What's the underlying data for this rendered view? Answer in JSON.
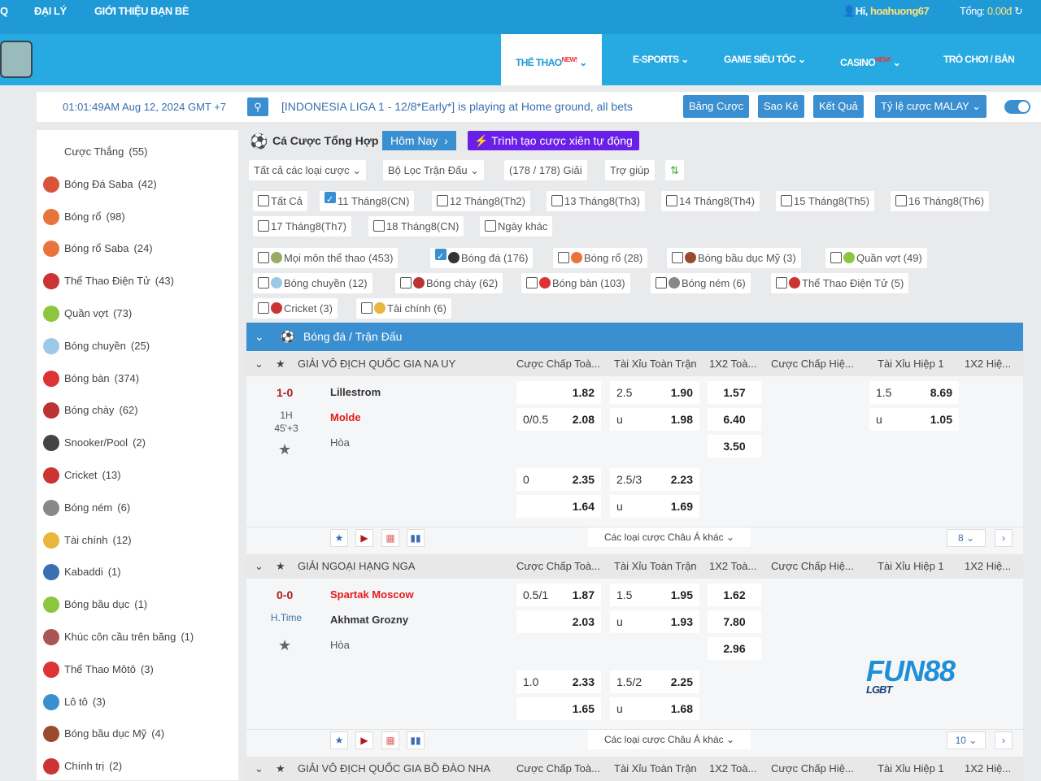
{
  "topbar": {
    "q": "Q",
    "agent": "ĐẠI LÝ",
    "refer": "GIỚI THIỆU BẠN BÈ",
    "greeting": "Hi,",
    "username": "hoahuong67",
    "total_label": "Tổng:",
    "total_value": "0.00đ"
  },
  "nav": [
    {
      "label": "THỂ THAO",
      "badge": "NEW!",
      "active": true
    },
    {
      "label": "E-SPORTS"
    },
    {
      "label": "GAME SIÊU TỐC"
    },
    {
      "label": "CASINO",
      "badge": "NEW!"
    },
    {
      "label": "TRÒ CHƠI / BẮN CÁ"
    }
  ],
  "infobar": {
    "datetime": "01:01:49AM Aug 12, 2024 GMT +7",
    "ticker": "[INDONESIA LIGA 1 - 12/8*Early*] is playing at Home ground, all bets",
    "buttons": [
      "Bảng Cược",
      "Sao Kê",
      "Kết Quả",
      "Tỷ lệ cược MALAY"
    ],
    "toggle_on": true
  },
  "sidebar": [
    {
      "label": "Cược Thắng",
      "count": "(55)"
    },
    {
      "label": "Bóng Đá Saba",
      "count": "(42)",
      "color": "#d9533b"
    },
    {
      "label": "Bóng rổ",
      "count": "(98)",
      "color": "#e8743b"
    },
    {
      "label": "Bóng rổ Saba",
      "count": "(24)",
      "color": "#e8743b"
    },
    {
      "label": "Thể Thao Điện Tử",
      "count": "(43)",
      "color": "#c33"
    },
    {
      "label": "Quần vợt",
      "count": "(73)",
      "color": "#8cc63f"
    },
    {
      "label": "Bóng chuyền",
      "count": "(25)",
      "color": "#9cc9e8"
    },
    {
      "label": "Bóng bàn",
      "count": "(374)",
      "color": "#d33"
    },
    {
      "label": "Bóng chày",
      "count": "(62)",
      "color": "#b33"
    },
    {
      "label": "Snooker/Pool",
      "count": "(2)",
      "color": "#444"
    },
    {
      "label": "Cricket",
      "count": "(13)",
      "color": "#c33"
    },
    {
      "label": "Bóng ném",
      "count": "(6)",
      "color": "#888"
    },
    {
      "label": "Tài chính",
      "count": "(12)",
      "color": "#e9b53b"
    },
    {
      "label": "Kabaddi",
      "count": "(1)",
      "color": "#3a6fb0"
    },
    {
      "label": "Bóng bầu dục",
      "count": "(1)",
      "color": "#8cc63f"
    },
    {
      "label": "Khúc côn cầu trên băng",
      "count": "(1)",
      "color": "#a55"
    },
    {
      "label": "Thể Thao Môtô",
      "count": "(3)",
      "color": "#d33"
    },
    {
      "label": "Lô tô",
      "count": "(3)",
      "color": "#3a8fd0"
    },
    {
      "label": "Bóng bầu dục Mỹ",
      "count": "(4)",
      "color": "#9b4b2b"
    },
    {
      "label": "Chính trị",
      "count": "(2)",
      "color": "#c33"
    }
  ],
  "main": {
    "title": "Cá Cược Tổng Hợp",
    "today": "Hôm Nay",
    "parlay": "Trình tạo cược xiên tự động",
    "filters": [
      "Tất cả các loại cược",
      "Bộ Lọc Trận Đấu",
      "(178 / 178) Giải",
      "Trợ giúp"
    ],
    "dates": [
      {
        "label": "Tất Cả",
        "checked": false
      },
      {
        "label": "11 Tháng8(CN)",
        "checked": true
      },
      {
        "label": "12 Tháng8(Th2)",
        "checked": false
      },
      {
        "label": "13 Tháng8(Th3)",
        "checked": false
      },
      {
        "label": "14 Tháng8(Th4)",
        "checked": false
      },
      {
        "label": "15 Tháng8(Th5)",
        "checked": false
      },
      {
        "label": "16 Tháng8(Th6)",
        "checked": false
      },
      {
        "label": "17 Tháng8(Th7)",
        "checked": false
      },
      {
        "label": "18 Tháng8(CN)",
        "checked": false
      },
      {
        "label": "Ngày khác",
        "checked": false
      }
    ],
    "sports": [
      {
        "label": "Mọi môn thể thao (453)",
        "checked": false,
        "color": "#9a6"
      },
      {
        "label": "Bóng đá (176)",
        "checked": true,
        "color": "#333"
      },
      {
        "label": "Bóng rổ (28)",
        "checked": false,
        "color": "#e8743b"
      },
      {
        "label": "Bóng bầu dục Mỹ (3)",
        "checked": false,
        "color": "#9b4b2b"
      },
      {
        "label": "Quần vợt (49)",
        "checked": false,
        "color": "#8cc63f"
      },
      {
        "label": "Bóng chuyền (12)",
        "checked": false,
        "color": "#9cc9e8"
      },
      {
        "label": "Bóng chày (62)",
        "checked": false,
        "color": "#b33"
      },
      {
        "label": "Bóng bàn (103)",
        "checked": false,
        "color": "#d33"
      },
      {
        "label": "Bóng ném (6)",
        "checked": false,
        "color": "#888"
      },
      {
        "label": "Thể Thao Điện Tử (5)",
        "checked": false,
        "color": "#c33"
      },
      {
        "label": "Cricket (3)",
        "checked": false,
        "color": "#c33"
      },
      {
        "label": "Tài chính (6)",
        "checked": false,
        "color": "#e9b53b"
      }
    ],
    "section": "Bóng đá / Trận Đấu",
    "columns": [
      "Cược Chấp Toà...",
      "Tài Xỉu Toàn Trận",
      "1X2 Toà...",
      "Cược Chấp Hiệ...",
      "Tài Xỉu Hiệp 1",
      "1X2 Hiệ..."
    ],
    "more_bets": "Các loại cược Châu Á khác",
    "leagues": [
      {
        "name": "GIẢI VÔ ĐỊCH QUỐC GIA NA UY",
        "score": "1-0",
        "period": "1H",
        "time": "45'+3",
        "home": "Lillestrom",
        "away": "Molde",
        "draw": "Hòa",
        "home_red": false,
        "away_red": true,
        "more_count": "8",
        "rows": [
          [
            "",
            "1.82",
            "2.5",
            "1.90",
            "1.57",
            "",
            "",
            "1.5",
            "8.69"
          ],
          [
            "0/0.5",
            "2.08",
            "u",
            "1.98",
            "6.40",
            "",
            "",
            "u",
            "1.05"
          ],
          [
            "",
            "",
            "",
            "",
            "3.50"
          ]
        ],
        "rows2": [
          [
            "0",
            "2.35",
            "2.5/3",
            "2.23"
          ],
          [
            "",
            "1.64",
            "u",
            "1.69"
          ]
        ]
      },
      {
        "name": "GIẢI NGOẠI HẠNG NGA",
        "score": "0-0",
        "period": "H.Time",
        "time": "",
        "home": "Spartak Moscow",
        "away": "Akhmat Grozny",
        "draw": "Hòa",
        "home_red": true,
        "away_red": false,
        "more_count": "10",
        "rows": [
          [
            "0.5/1",
            "1.87",
            "1.5",
            "1.95",
            "1.62"
          ],
          [
            "",
            "2.03",
            "u",
            "1.93",
            "7.80"
          ],
          [
            "",
            "",
            "",
            "",
            "2.96"
          ]
        ],
        "rows2": [
          [
            "1.0",
            "2.33",
            "1.5/2",
            "2.25"
          ],
          [
            "",
            "1.65",
            "u",
            "1.68"
          ]
        ]
      },
      {
        "name": "GIẢI VÔ ĐỊCH QUỐC GIA BỒ ĐÀO NHA"
      }
    ]
  },
  "watermark": {
    "brand": "FUN88",
    "sub": "LGBT"
  },
  "colors": {
    "topbar": "#1f9ad6",
    "navbar": "#27a9e1",
    "accent": "#3a8fd0",
    "parlay": "#6a1fe8",
    "red": "#e31b1b"
  }
}
